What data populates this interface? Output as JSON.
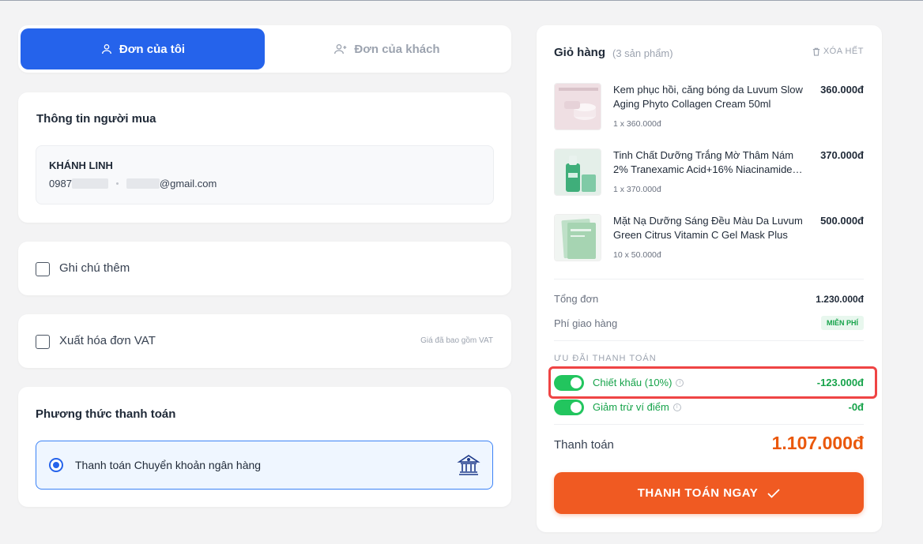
{
  "tabs": {
    "my_order": "Đơn của tôi",
    "customer_order": "Đơn của khách"
  },
  "buyer": {
    "section_title": "Thông tin người mua",
    "name": "KHÁNH LINH",
    "phone_prefix": "0987",
    "email_suffix": "@gmail.com"
  },
  "note": {
    "label": "Ghi chú thêm"
  },
  "vat": {
    "label": "Xuất hóa đơn VAT",
    "hint": "Giá đã bao gồm VAT"
  },
  "payment": {
    "section_title": "Phương thức thanh toán",
    "option_label": "Thanh toán Chuyển khoản ngân hàng"
  },
  "cart": {
    "title": "Giỏ hàng",
    "count": "(3 sản phẩm)",
    "clear_all": "XÓA HẾT",
    "items": [
      {
        "name": "Kem phục hồi, căng bóng da Luvum Slow Aging Phyto Collagen Cream 50ml",
        "qty": "1 x 360.000đ",
        "price": "360.000đ"
      },
      {
        "name": "Tinh Chất Dưỡng Trắng Mờ Thâm Nám 2% Tranexamic Acid+16% Niacinamide Luvum Brightening Serum",
        "qty": "1 x 370.000đ",
        "price": "370.000đ"
      },
      {
        "name": "Mặt Nạ Dưỡng Sáng Đều Màu Da Luvum Green Citrus Vitamin C Gel Mask Plus",
        "qty": "10 x 50.000đ",
        "price": "500.000đ"
      }
    ],
    "subtotal_label": "Tổng đơn",
    "subtotal_value": "1.230.000đ",
    "shipping_label": "Phí giao hàng",
    "shipping_value": "MIỄN PHÍ",
    "promo_heading": "ƯU ĐÃI THANH TOÁN",
    "discount_label": "Chiết khấu (10%)",
    "discount_value": "-123.000đ",
    "points_label": "Giảm trừ ví điểm",
    "points_value": "-0đ",
    "total_label": "Thanh toán",
    "total_value": "1.107.000đ",
    "checkout_label": "THANH TOÁN NGAY"
  }
}
